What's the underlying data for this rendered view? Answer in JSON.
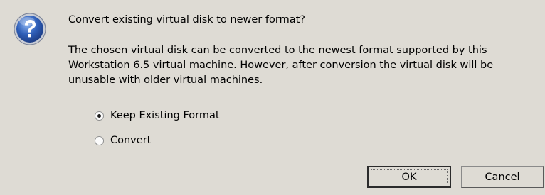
{
  "dialog": {
    "icon": "question-icon",
    "title": "Convert existing virtual disk to newer format?",
    "message": "The chosen virtual disk can be converted to the newest format supported by this Workstation 6.5 virtual machine.  However, after conversion the virtual disk will be unusable with older virtual machines.",
    "options": [
      {
        "label": "Keep Existing Format",
        "selected": true
      },
      {
        "label": "Convert",
        "selected": false
      }
    ],
    "buttons": {
      "ok_label": "OK",
      "cancel_label": "Cancel"
    }
  },
  "colors": {
    "dialog_background": "#dedbd4",
    "icon_blue": "#2f5fb8"
  }
}
